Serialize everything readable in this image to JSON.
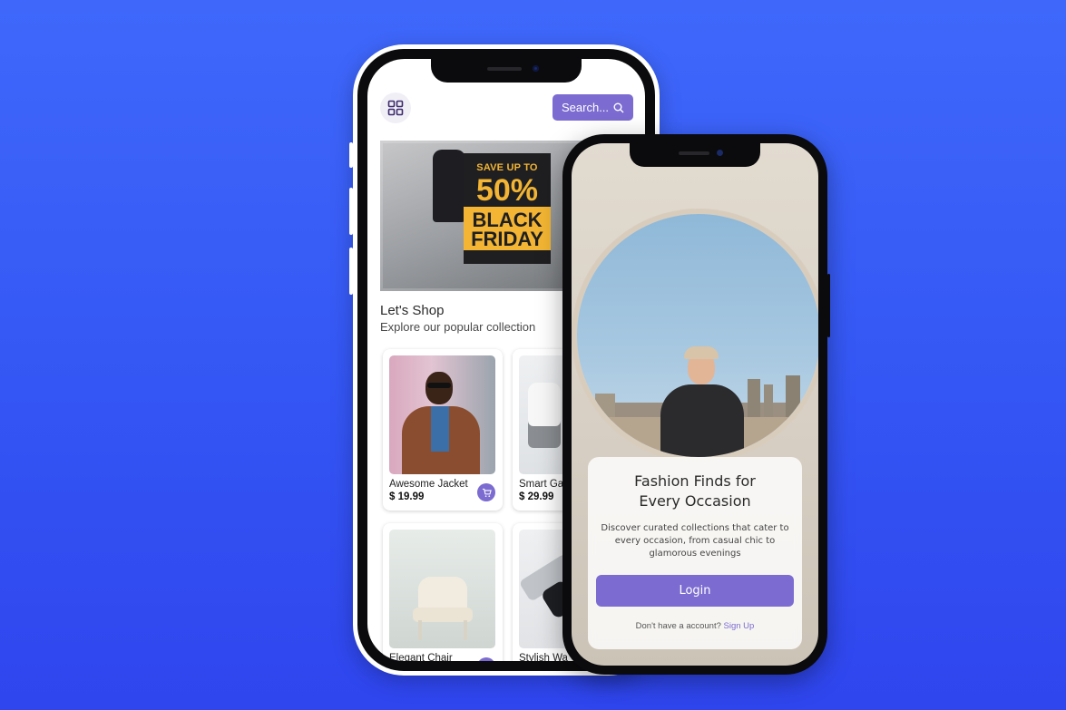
{
  "shop_app": {
    "search": {
      "label": "Search...",
      "icon": "search-icon"
    },
    "menu": {
      "icon": "grid-icon"
    },
    "banner": {
      "line1": "SAVE UP TO",
      "line2": "50%",
      "line3": "BLACK FRIDAY"
    },
    "section": {
      "title": "Let's Shop",
      "subtitle": "Explore our popular collection"
    },
    "products": [
      {
        "name": "Awesome Jacket",
        "price": "$ 19.99"
      },
      {
        "name": "Smart Ga",
        "price": "$ 29.99"
      },
      {
        "name": "Elegant Chair",
        "price": ""
      },
      {
        "name": "Stylish Wa",
        "price": ""
      }
    ],
    "accent_color": "#7c6bd0"
  },
  "login_app": {
    "title_line1": "Fashion Finds for",
    "title_line2": "Every Occasion",
    "description": "Discover curated collections that cater to every occasion, from casual chic to glamorous evenings",
    "login_label": "Login",
    "signup_prompt": "Don't have a account?",
    "signup_link": "Sign Up"
  },
  "background_color": "#3456f4"
}
